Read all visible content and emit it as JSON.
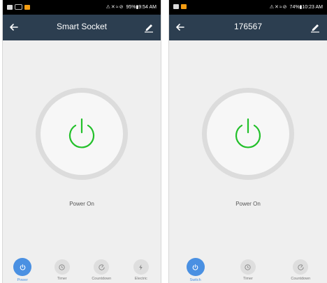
{
  "screens": [
    {
      "status_bar": {
        "right_text": "95%▮9:54 AM"
      },
      "app_bar": {
        "title": "Smart Socket"
      },
      "power": {
        "state_text": "Power On",
        "ring_color": "#22c02a"
      },
      "nav": [
        {
          "label": "Power",
          "icon": "power-icon",
          "active": true
        },
        {
          "label": "Timer",
          "icon": "timer-icon",
          "active": false
        },
        {
          "label": "Countdown",
          "icon": "countdown-icon",
          "active": false
        },
        {
          "label": "Electric",
          "icon": "electric-icon",
          "active": false
        }
      ]
    },
    {
      "status_bar": {
        "right_text": "74%▮10:23 AM"
      },
      "app_bar": {
        "title": "176567"
      },
      "power": {
        "state_text": "Power On",
        "ring_color": "#22c02a"
      },
      "nav": [
        {
          "label": "Switch",
          "icon": "power-icon",
          "active": true
        },
        {
          "label": "Timer",
          "icon": "timer-icon",
          "active": false
        },
        {
          "label": "Countdown",
          "icon": "countdown-icon",
          "active": false
        }
      ]
    }
  ],
  "colors": {
    "app_bar": "#2c3e50",
    "accent": "#4a90e2",
    "power_green": "#22c02a"
  }
}
